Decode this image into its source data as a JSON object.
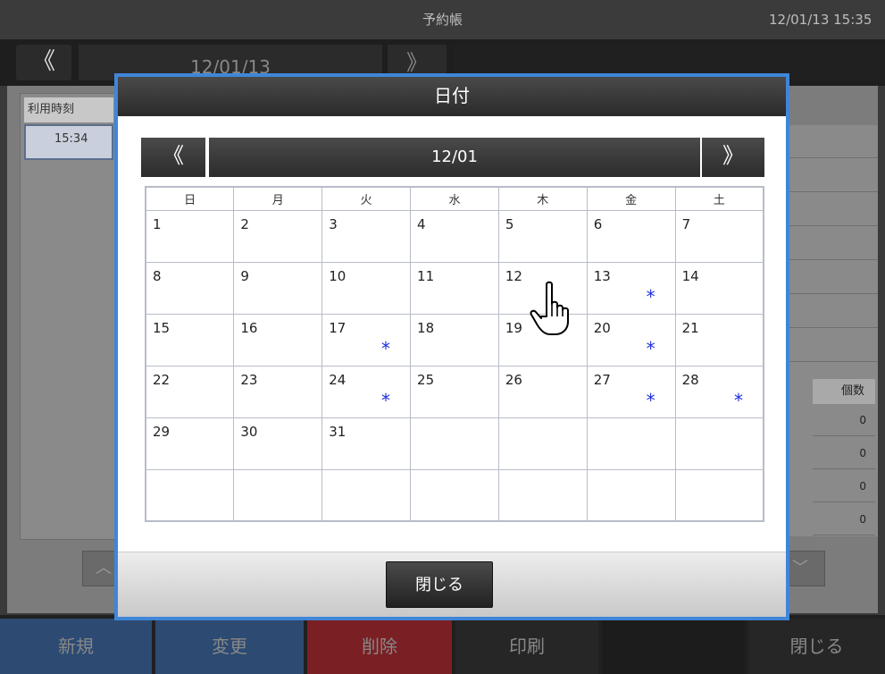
{
  "titlebar": {
    "title": "予約帳",
    "datetime": "12/01/13 15:35"
  },
  "date_nav": {
    "prev_glyph": "《",
    "date": "12/01/13",
    "next_glyph": "》"
  },
  "left_col": {
    "header": "利用時刻",
    "time": "15:34"
  },
  "right_col": {
    "qty_header": "個数",
    "quantities": [
      "0",
      "0",
      "0",
      "0"
    ]
  },
  "scroll": {
    "up_glyph": "︿",
    "down_glyph": "﹀"
  },
  "bottom_bar": {
    "new_label": "新規",
    "edit_label": "変更",
    "delete_label": "削除",
    "print_label": "印刷",
    "close_label": "閉じる"
  },
  "dialog": {
    "title": "日付",
    "prev_glyph": "《",
    "month": "12/01",
    "next_glyph": "》",
    "weekdays": [
      "日",
      "月",
      "火",
      "水",
      "木",
      "金",
      "土"
    ],
    "mark_glyph": "*",
    "weeks": [
      [
        {
          "d": "1"
        },
        {
          "d": "2"
        },
        {
          "d": "3"
        },
        {
          "d": "4"
        },
        {
          "d": "5"
        },
        {
          "d": "6"
        },
        {
          "d": "7"
        }
      ],
      [
        {
          "d": "8"
        },
        {
          "d": "9"
        },
        {
          "d": "10"
        },
        {
          "d": "11"
        },
        {
          "d": "12"
        },
        {
          "d": "13",
          "mark": true
        },
        {
          "d": "14"
        }
      ],
      [
        {
          "d": "15"
        },
        {
          "d": "16"
        },
        {
          "d": "17",
          "mark": true
        },
        {
          "d": "18"
        },
        {
          "d": "19"
        },
        {
          "d": "20",
          "mark": true
        },
        {
          "d": "21"
        }
      ],
      [
        {
          "d": "22"
        },
        {
          "d": "23"
        },
        {
          "d": "24",
          "mark": true
        },
        {
          "d": "25"
        },
        {
          "d": "26"
        },
        {
          "d": "27",
          "mark": true
        },
        {
          "d": "28",
          "mark": true
        }
      ],
      [
        {
          "d": "29"
        },
        {
          "d": "30"
        },
        {
          "d": "31"
        },
        {
          "d": ""
        },
        {
          "d": ""
        },
        {
          "d": ""
        },
        {
          "d": ""
        }
      ],
      [
        {
          "d": ""
        },
        {
          "d": ""
        },
        {
          "d": ""
        },
        {
          "d": ""
        },
        {
          "d": ""
        },
        {
          "d": ""
        },
        {
          "d": ""
        }
      ]
    ],
    "close_label": "閉じる"
  },
  "colors": {
    "accent_frame": "#3f86d8",
    "mark": "#1a2fe0",
    "new_button": "#2c4a72",
    "delete_button": "#7a1f24"
  }
}
